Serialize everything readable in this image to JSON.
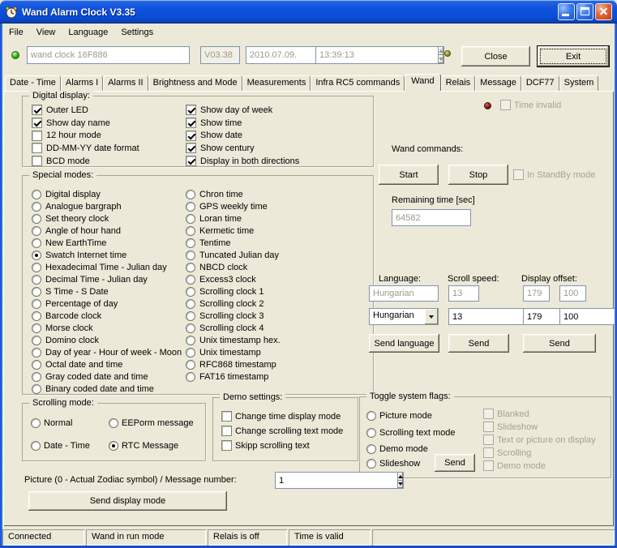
{
  "window": {
    "title": "Wand Alarm Clock V3.35"
  },
  "icons": {
    "app": "alarm-clock",
    "titlebar_buttons": [
      "minimize",
      "maximize",
      "close"
    ],
    "spinner": "up-down-arrows",
    "combo": "dropdown-arrow"
  },
  "colors": {
    "titlebar_blue": "#0E51DB",
    "led_connection": "#38C80A",
    "led_aux": "#8F8F1E",
    "led_time_invalid": "#8B0F0F",
    "background": "#ECE9D8"
  },
  "menu": {
    "items": [
      {
        "label": "File"
      },
      {
        "label": "View"
      },
      {
        "label": "Language"
      },
      {
        "label": "Settings"
      }
    ]
  },
  "toolbar": {
    "device_field": "wand clock 16F886",
    "version_field": "V03.38",
    "date_field": "2010.07.09.",
    "time_field": "13:39:13",
    "close_button": "Close",
    "exit_button": "Exit"
  },
  "tabs": {
    "items": [
      {
        "label": "Date - Time"
      },
      {
        "label": "Alarms I"
      },
      {
        "label": "Alarms II"
      },
      {
        "label": "Brightness and Mode"
      },
      {
        "label": "Measurements"
      },
      {
        "label": "Infra RC5 commands"
      },
      {
        "label": "Wand",
        "selected": true
      },
      {
        "label": "Relais"
      },
      {
        "label": "Message"
      },
      {
        "label": "DCF77"
      },
      {
        "label": "System"
      }
    ]
  },
  "digital_display": {
    "title": "Digital display:",
    "left": [
      {
        "label": "Outer LED",
        "checked": true
      },
      {
        "label": "Show day name",
        "checked": true
      },
      {
        "label": "12 hour mode",
        "checked": false
      },
      {
        "label": "DD-MM-YY date format",
        "checked": false
      },
      {
        "label": "BCD mode",
        "checked": false
      }
    ],
    "right": [
      {
        "label": "Show day of week",
        "checked": true
      },
      {
        "label": "Show time",
        "checked": true
      },
      {
        "label": "Show date",
        "checked": true
      },
      {
        "label": "Show century",
        "checked": true
      },
      {
        "label": "Display in both directions",
        "checked": true
      }
    ]
  },
  "special_modes": {
    "title": "Special modes:",
    "selected": "Swatch Internet time",
    "left": [
      "Digital display",
      "Analogue bargraph",
      "Set theory clock",
      "Angle of hour hand",
      "New EarthTime",
      "Swatch Internet time",
      "Hexadecimal Time - Julian day",
      "Decimal Time - Julian day",
      "S Time - S Date",
      "Percentage of day",
      "Barcode clock",
      "Morse clock",
      "Domino clock",
      "Day of year - Hour of week - Moon",
      "Octal date and time",
      "Gray coded date and time",
      "Binary coded date and time"
    ],
    "right": [
      "Chron time",
      "GPS weekly time",
      "Loran time",
      "Kermetic time",
      "Tentime",
      "Tuncated Julian day",
      "NBCD clock",
      "Excess3 clock",
      "Scrolling clock 1",
      "Scrolling clock 2",
      "Scrolling clock 3",
      "Scrolling clock 4",
      "Unix timestamp hex.",
      "Unix timestamp",
      "RFC868 timestamp",
      "FAT16 timestamp"
    ]
  },
  "wand_panel": {
    "time_invalid_label": "Time invalid",
    "commands_label": "Wand commands:",
    "start_button": "Start",
    "stop_button": "Stop",
    "standby_label": "In StandBy mode",
    "remaining_label": "Remaining time [sec]",
    "remaining_value": "64582",
    "language_label": "Language:",
    "scroll_speed_label": "Scroll speed:",
    "display_offset_label": "Display offset:",
    "language_value": "Hungarian",
    "scroll_speed_value": "13",
    "offset1_value": "179",
    "offset2_value": "100",
    "language_select": "Hungarian",
    "scroll_speed_spin": "13",
    "offset1_spin": "179",
    "offset2_spin": "100",
    "send_language_button": "Send language",
    "send_speed_button": "Send",
    "send_offset_button": "Send"
  },
  "scrolling_mode": {
    "title": "Scrolling mode:",
    "options": [
      {
        "label": "Normal",
        "selected": false
      },
      {
        "label": "EEPorm message",
        "selected": false
      },
      {
        "label": "Date - Time",
        "selected": false
      },
      {
        "label": "RTC Message",
        "selected": true
      }
    ]
  },
  "demo_settings": {
    "title": "Demo settings:",
    "options": [
      {
        "label": "Change time display mode",
        "checked": false
      },
      {
        "label": "Change scrolling text mode",
        "checked": false
      },
      {
        "label": "Skipp scrolling text",
        "checked": false
      }
    ]
  },
  "toggle_flags": {
    "title": "Toggle system flags:",
    "modes": [
      {
        "label": "Picture mode",
        "selected": false
      },
      {
        "label": "Scrolling text mode",
        "selected": false
      },
      {
        "label": "Demo mode",
        "selected": false
      },
      {
        "label": "Slideshow",
        "selected": false
      }
    ],
    "send_button": "Send",
    "flags": [
      {
        "label": "Blanked",
        "checked": false
      },
      {
        "label": "Slideshow",
        "checked": false
      },
      {
        "label": "Text or picture on display",
        "checked": false
      },
      {
        "label": "Scrolling",
        "checked": false
      },
      {
        "label": "Demo mode",
        "checked": false
      }
    ]
  },
  "bottom": {
    "picture_label": "Picture (0 - Actual Zodiac symbol)  /  Message number:",
    "picture_value": "1",
    "send_display_button": "Send display mode"
  },
  "statusbar": {
    "panels": [
      {
        "text": "Connected"
      },
      {
        "text": "Wand in run mode"
      },
      {
        "text": "Relais is off"
      },
      {
        "text": "Time is valid"
      }
    ]
  }
}
